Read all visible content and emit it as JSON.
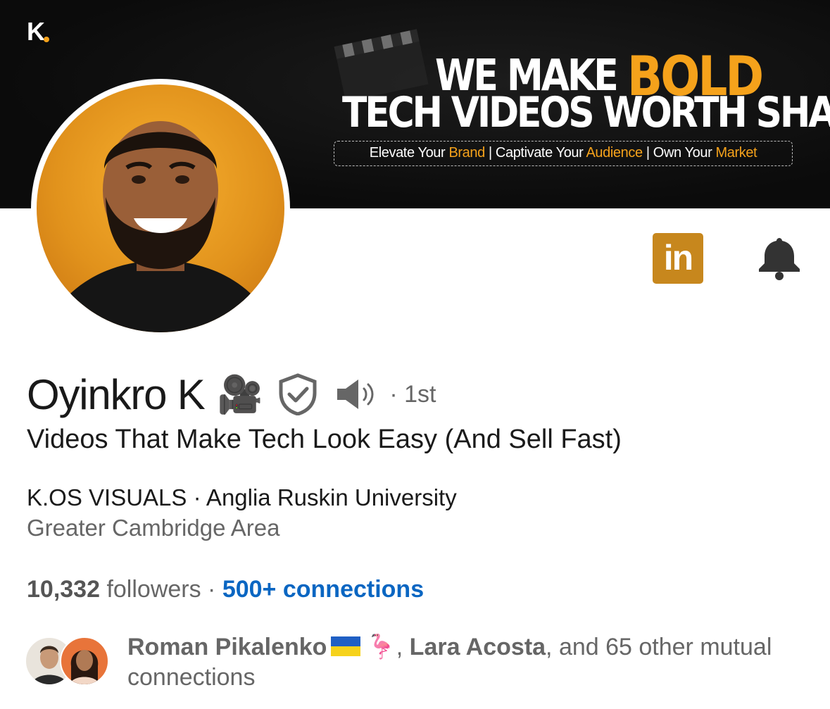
{
  "banner": {
    "logo": "K",
    "headline_part1": "WE MAKE ",
    "headline_bold": "BOLD",
    "headline_line2": "TECH VIDEOS WORTH SHARING",
    "tagline": {
      "p1": "Elevate Your ",
      "h1": "Brand",
      "p2": " | Captivate Your ",
      "h2": "Audience",
      "p3": " | Own Your ",
      "h3": "Market"
    }
  },
  "actions": {
    "linkedin_label": "in",
    "bell_icon": "bell-icon"
  },
  "profile": {
    "name": "Oyinkro K",
    "name_emoji": "🎥",
    "degree": "· 1st",
    "headline": "Videos That Make Tech Look Easy (And Sell Fast)",
    "company_line": "K.OS VISUALS · Anglia Ruskin University",
    "location": "Greater Cambridge Area"
  },
  "stats": {
    "followers_count": "10,332",
    "followers_label": " followers · ",
    "connections": "500+ connections"
  },
  "mutual": {
    "name1": "Roman Pikalenko",
    "flamingo": "🦩",
    "sep": ", ",
    "name2": "Lara Acosta",
    "rest": ", and 65 other mutual connections"
  },
  "colors": {
    "accent_orange": "#f5a21b",
    "linkedin_button": "#c7871d",
    "link_blue": "#0a66c2"
  }
}
